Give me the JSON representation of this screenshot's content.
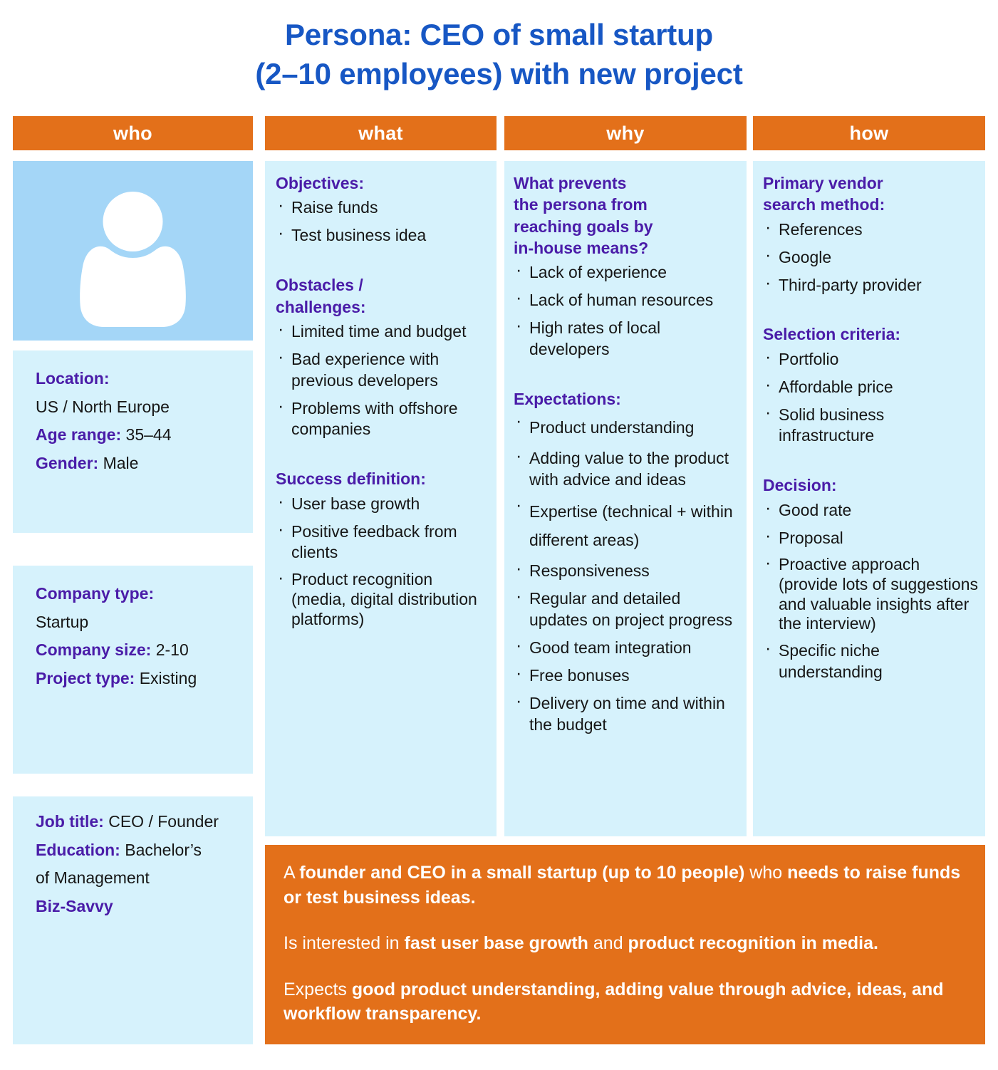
{
  "title": {
    "line1": "Persona: CEO of small startup",
    "line2": "(2–10 employees) with new project",
    "color": "#1757c4"
  },
  "colors": {
    "accent_orange": "#e3701a",
    "panel_blue": "#d6f2fc",
    "avatar_blue": "#a4d6f7",
    "label_purple": "#4a1ca8",
    "title_blue": "#1757c4",
    "text_dark": "#161616"
  },
  "headers": {
    "who": "who",
    "what": "what",
    "why": "why",
    "how": "how"
  },
  "who": {
    "avatar_icon": "person-avatar-icon",
    "block1": {
      "location_label": "Location:",
      "location_value": "US / North Europe",
      "age_label": "Age range:",
      "age_value": "35–44",
      "gender_label": "Gender:",
      "gender_value": "Male"
    },
    "block2": {
      "company_type_label": "Company type:",
      "company_type_value": "Startup",
      "company_size_label": "Company size:",
      "company_size_value": "2-10",
      "project_type_label": "Project type:",
      "project_type_value": "Existing"
    },
    "block3": {
      "job_title_label": "Job title:",
      "job_title_value": "CEO / Founder",
      "education_label": "Education:",
      "education_value": "Bachelor’s",
      "education_value_line2": "of Management",
      "biz_savvy": "Biz-Savvy"
    }
  },
  "what": {
    "objectives_title": "Objectives:",
    "objectives": [
      "Raise funds",
      "Test business idea"
    ],
    "obstacles_title_line1": "Obstacles /",
    "obstacles_title_line2": "challenges:",
    "obstacles": [
      "Limited time and budget",
      "Bad experience with previous developers",
      "Problems with offshore companies"
    ],
    "success_title": "Success definition:",
    "success": [
      "User base growth",
      "Positive feedback from clients",
      "Product recognition (media, digital distribution platforms)"
    ]
  },
  "why": {
    "prevents_title_line1": "What prevents",
    "prevents_title_line2": "the persona from",
    "prevents_title_line3": "reaching goals by",
    "prevents_title_line4": "in-house means?",
    "prevents": [
      "Lack of experience",
      "Lack of human resources",
      "High rates of local developers"
    ],
    "expectations_title": "Expectations:",
    "expectations": [
      "Product understanding",
      "Adding value to the product with advice and ideas",
      "Expertise (technical + within different areas)",
      "Responsiveness",
      "Regular and detailed updates on project progress",
      "Good team integration",
      "Free bonuses",
      "Delivery on time and within the budget"
    ]
  },
  "how": {
    "vendor_title_line1": "Primary vendor",
    "vendor_title_line2": "search method:",
    "vendor_methods": [
      "References",
      "Google",
      "Third-party provider"
    ],
    "selection_title": "Selection criteria:",
    "selection": [
      "Portfolio",
      "Affordable price",
      "Solid business infrastructure"
    ],
    "decision_title": "Decision:",
    "decision": [
      "Good rate",
      "Proposal",
      "Proactive approach (provide lots of suggestions and valuable insights after the interview)",
      "Specific niche understanding"
    ]
  },
  "summary": {
    "p1_a": "A ",
    "p1_b": "founder and CEO in a small startup (up to 10 people)",
    "p1_c": " who ",
    "p1_d": "needs to raise funds or test business ideas.",
    "p2_a": "Is interested in ",
    "p2_b": "fast user base growth",
    "p2_c": " and ",
    "p2_d": "product recognition in media.",
    "p3_a": "Expects ",
    "p3_b": "good product understanding, adding value through advice, ideas, and workflow transparency."
  }
}
